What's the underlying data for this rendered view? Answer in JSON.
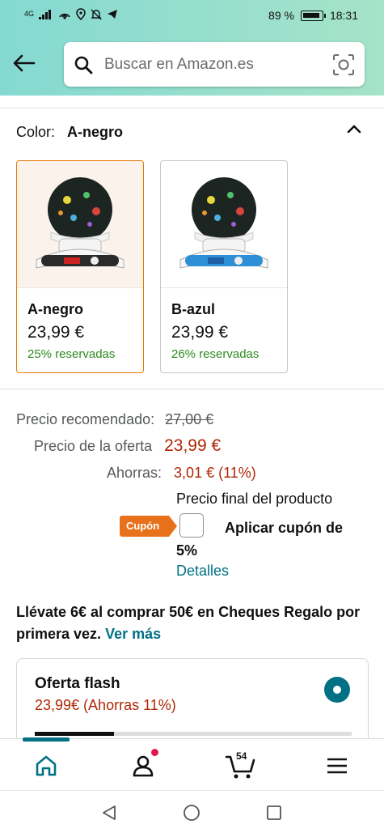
{
  "status_bar": {
    "network": "4G",
    "battery": "89 %",
    "time": "18:31"
  },
  "search": {
    "placeholder": "Buscar en Amazon.es"
  },
  "color_selector": {
    "label": "Color:",
    "selected": "A-negro",
    "options": [
      {
        "name": "A-negro",
        "price": "23,99 €",
        "claimed": "25% reservadas"
      },
      {
        "name": "B-azul",
        "price": "23,99 €",
        "claimed": "26% reservadas"
      }
    ]
  },
  "pricing": {
    "rrp_label": "Precio recomendado:",
    "rrp_value": "27,00 €",
    "deal_label": "Precio de la oferta",
    "deal_value": "23,99 €",
    "savings_label": "Ahorras:",
    "savings_value": "3,01 € (11%)",
    "final_price_note": "Precio final del producto"
  },
  "coupon": {
    "tag": "Cupón",
    "apply_label": "Aplicar cupón de 5%",
    "details_link": "Detalles"
  },
  "gift_promo": {
    "text": "Llévate 6€ al comprar 50€ en Cheques Regalo por primera vez.",
    "link": "Ver más"
  },
  "flash_offer": {
    "title": "Oferta flash",
    "subtitle": "23,99€ (Ahorras 11%)",
    "progress": 0.25
  },
  "bottom_nav": {
    "cart_count": "54"
  },
  "colors": {
    "accent_teal": "#007185",
    "price_red": "#b12704",
    "coupon_orange": "#e8711b",
    "selected_border": "#e77600"
  }
}
